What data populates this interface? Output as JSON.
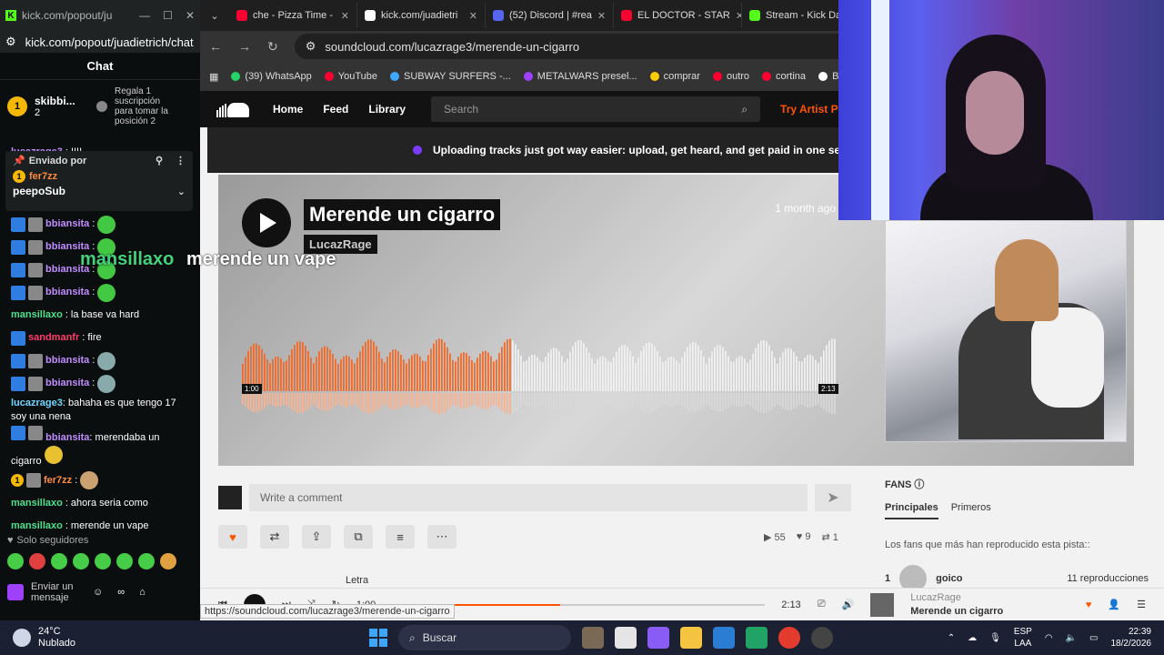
{
  "kick": {
    "window_title": "kick.com/popout/juadietrich/chat",
    "window_controls": [
      "—",
      "☐",
      "✕"
    ],
    "url": "kick.com/popout/juadietrich/chat",
    "chat_title": "Chat",
    "gift": {
      "rank": "1",
      "user": "skibbi...",
      "count": "2",
      "cta": "Regala 1 suscripción para tomar la posición",
      "position": "2"
    },
    "pinned": {
      "label": "Enviado por",
      "user": "fer7zz",
      "badge": "1",
      "message": "peepoSub"
    },
    "messages": [
      {
        "user": "lucazrage3",
        "text": "!!!!"
      },
      {
        "user": "bbiansita",
        "text": ""
      },
      {
        "user": "bbiansita",
        "text": ""
      },
      {
        "user": "bbiansita",
        "text": ""
      },
      {
        "user": "bbiansita",
        "text": ""
      },
      {
        "user": "mansillaxo",
        "text": "la base va hard"
      },
      {
        "user": "sandmanfr",
        "text": "fire"
      },
      {
        "user": "bbiansita",
        "text": ""
      },
      {
        "user": "bbiansita",
        "text": ""
      },
      {
        "user": "lucazrage3",
        "text": "bahaha es que tengo 17 soy una nena"
      },
      {
        "user": "bbiansita",
        "text": "merendaba un cigarro"
      },
      {
        "user": "fer7zz",
        "text": ""
      },
      {
        "user": "mansillaxo",
        "text": "ahora seria como"
      },
      {
        "user": "mansillaxo",
        "text": "merende un vape"
      }
    ],
    "followers_only": "Solo seguidores",
    "send_placeholder": "Enviar un mensaje"
  },
  "overlay": {
    "name": "mansillaxo",
    "text": "merende un vape"
  },
  "chrome": {
    "tabs": [
      {
        "title": "che - Pizza Time -",
        "color": "#ff0033"
      },
      {
        "title": "kick.com/juadietri",
        "color": "#ffffff"
      },
      {
        "title": "(52) Discord | #rea",
        "color": "#5865f2"
      },
      {
        "title": "EL DOCTOR - STAR",
        "color": "#ff0033"
      },
      {
        "title": "Stream - Kick Das",
        "color": "#53fc18"
      }
    ],
    "url": "soundcloud.com/lucazrage3/merende-un-cigarro",
    "bookmarks": [
      {
        "label": "(39) WhatsApp",
        "color": "#25d366"
      },
      {
        "label": "YouTube",
        "color": "#ff0033"
      },
      {
        "label": "SUBWAY SURFERS -...",
        "color": "#3ea6ff"
      },
      {
        "label": "METALWARS presel...",
        "color": "#a040ff"
      },
      {
        "label": "comprar",
        "color": "#ffcc00"
      },
      {
        "label": "outro",
        "color": "#ff0033"
      },
      {
        "label": "cortina",
        "color": "#ff0033"
      },
      {
        "label": "BOTR",
        "color": "#ffffff"
      }
    ],
    "status_url": "https://soundcloud.com/lucazrage3/merende-un-cigarro"
  },
  "soundcloud": {
    "nav": {
      "home": "Home",
      "feed": "Feed",
      "library": "Library",
      "search_placeholder": "Search",
      "try": "Try Artist Pro"
    },
    "banner": "Uploading tracks just got way easier: upload, get heard, and get paid in one seamless e",
    "track": {
      "title": "Merende un cigarro",
      "artist": "LucazRage",
      "posted": "1 month ago",
      "elapsed": "1:00",
      "duration": "2:13",
      "progress": 0.45
    },
    "comment_placeholder": "Write a comment",
    "stats": {
      "plays": "55",
      "likes": "9",
      "reposts": "1"
    },
    "lyrics_label": "Letra",
    "fans": {
      "title": "FANS",
      "tabs": [
        "Principales",
        "Primeros"
      ],
      "note": "Los fans que más han reproducido esta pista::",
      "top": {
        "rank": "1",
        "name": "goico",
        "plays": "11 reproducciones"
      }
    },
    "player": {
      "elapsed": "1:00",
      "duration": "2:13",
      "artist": "LucazRage",
      "title": "Merende un cigarro"
    }
  },
  "taskbar": {
    "temp": "24°C",
    "weather": "Nublado",
    "search": "Buscar",
    "lang": "ESP",
    "lang2": "LAA",
    "time": "22:39",
    "date": "18/2/2026"
  },
  "colors": {
    "sc_orange": "#ff5500",
    "kick_green": "#53fc18"
  }
}
